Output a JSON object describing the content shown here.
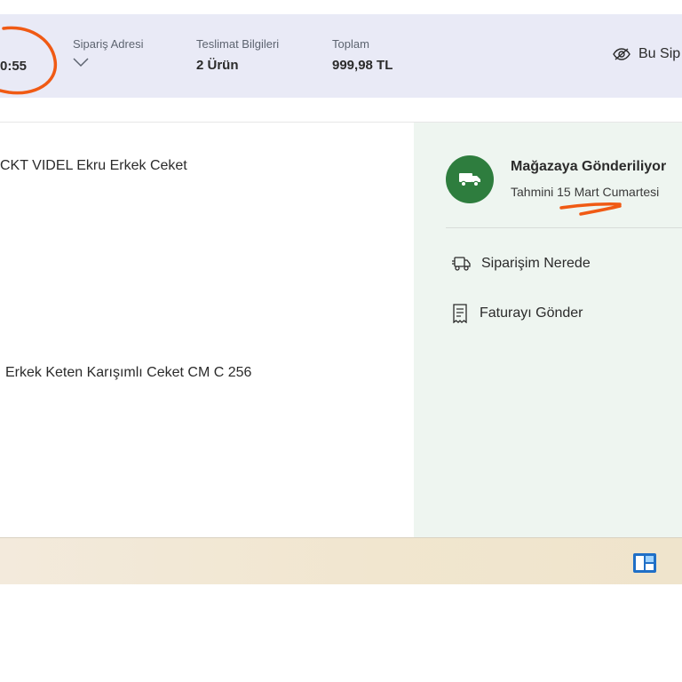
{
  "header": {
    "time_fragment": "0:55",
    "address": {
      "label": "Sipariş Adresi"
    },
    "delivery": {
      "label": "Teslimat Bilgileri",
      "value": "2 Ürün"
    },
    "total": {
      "label": "Toplam",
      "value": "999,98 TL"
    },
    "hide_button_label": "Bu Sip"
  },
  "products": [
    {
      "name": "CKT VIDEL Ekru Erkek Ceket"
    },
    {
      "name": "Erkek Keten Karışımlı Ceket CM C 256"
    }
  ],
  "shipment": {
    "status": "Mağazaya Gönderiliyor",
    "eta": "Tahmini 15 Mart Cumartesi"
  },
  "actions": [
    {
      "label": "Siparişim Nerede",
      "icon": "truck-outline-icon"
    },
    {
      "label": "Faturayı Gönder",
      "icon": "receipt-icon"
    }
  ],
  "colors": {
    "header_bg": "#e9eaf6",
    "status_green": "#2e7d3e",
    "panel_bg": "#eef5f0",
    "annotation_orange": "#f05a14"
  }
}
